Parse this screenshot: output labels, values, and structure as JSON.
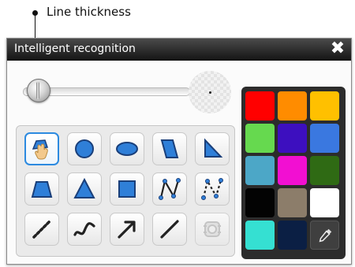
{
  "callout": {
    "label": "Line thickness"
  },
  "dialog": {
    "title": "Intelligent recognition",
    "close_glyph": "✖"
  },
  "line_thickness": {
    "value": 0.03
  },
  "tools": [
    {
      "name": "tool-smart-shape-recognition",
      "icon": "smart-recognition-icon",
      "selected": true
    },
    {
      "name": "tool-circle",
      "icon": "circle-icon"
    },
    {
      "name": "tool-ellipse",
      "icon": "ellipse-icon"
    },
    {
      "name": "tool-parallelogram",
      "icon": "parallelogram-icon"
    },
    {
      "name": "tool-right-triangle",
      "icon": "right-triangle-icon"
    },
    {
      "name": "tool-trapezoid",
      "icon": "trapezoid-icon"
    },
    {
      "name": "tool-triangle",
      "icon": "triangle-icon"
    },
    {
      "name": "tool-square",
      "icon": "square-icon"
    },
    {
      "name": "tool-polyline",
      "icon": "polyline-icon"
    },
    {
      "name": "tool-dashed-polyline",
      "icon": "dashed-polyline-icon"
    },
    {
      "name": "tool-dotted-line",
      "icon": "dotted-line-icon"
    },
    {
      "name": "tool-freehand-curve",
      "icon": "wave-icon"
    },
    {
      "name": "tool-arrow",
      "icon": "arrow-icon"
    },
    {
      "name": "tool-line",
      "icon": "line-icon"
    },
    {
      "name": "tool-magic-shape",
      "icon": "magic-shape-icon",
      "disabled": true
    }
  ],
  "palette": {
    "colors": [
      "#ff0000",
      "#ff8c00",
      "#ffc000",
      "#66d94f",
      "#3d0fbf",
      "#3a78e0",
      "#4ca7c7",
      "#f20fd2",
      "#2f6a14",
      "#030303",
      "#8c7d6a",
      "#ffffff",
      "#35e0d2",
      "#0b1f44"
    ],
    "eyedropper_icon": "eyedropper-icon"
  }
}
